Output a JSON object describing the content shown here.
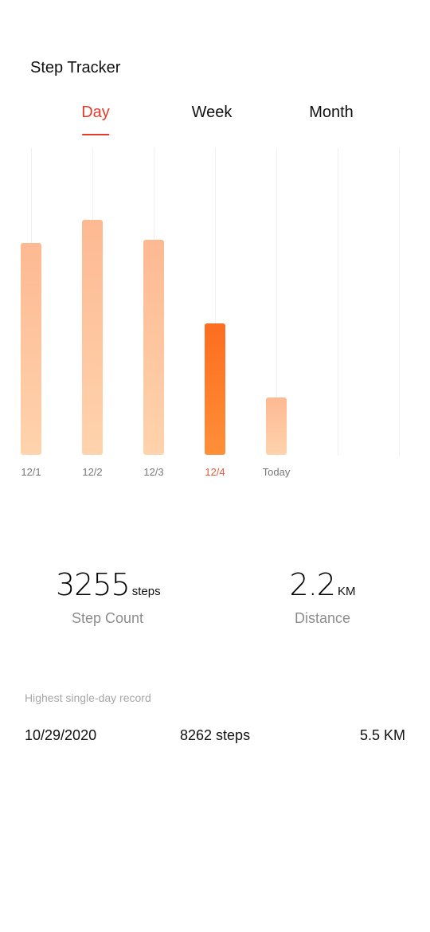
{
  "header": {
    "title": "Step Tracker"
  },
  "tabs": [
    {
      "label": "Day",
      "active": true
    },
    {
      "label": "Week",
      "active": false
    },
    {
      "label": "Month",
      "active": false
    }
  ],
  "chart_data": {
    "type": "bar",
    "categories": [
      "12/1",
      "12/2",
      "12/3",
      "12/4",
      "Today"
    ],
    "values": [
      5150,
      5720,
      5220,
      3200,
      1400
    ],
    "selected_category": "12/4",
    "colors": {
      "bar": "#fdb992",
      "selected_bar": "#fc6d20",
      "selected_label": "#e8593b"
    },
    "grid": true
  },
  "stats": {
    "steps": {
      "value": "3255",
      "unit": "steps",
      "caption": "Step Count"
    },
    "distance": {
      "value": "2.2",
      "unit": "KM",
      "caption": "Distance"
    }
  },
  "record": {
    "title": "Highest single-day record",
    "date": "10/29/2020",
    "steps": "8262 steps",
    "distance": "5.5 KM"
  }
}
